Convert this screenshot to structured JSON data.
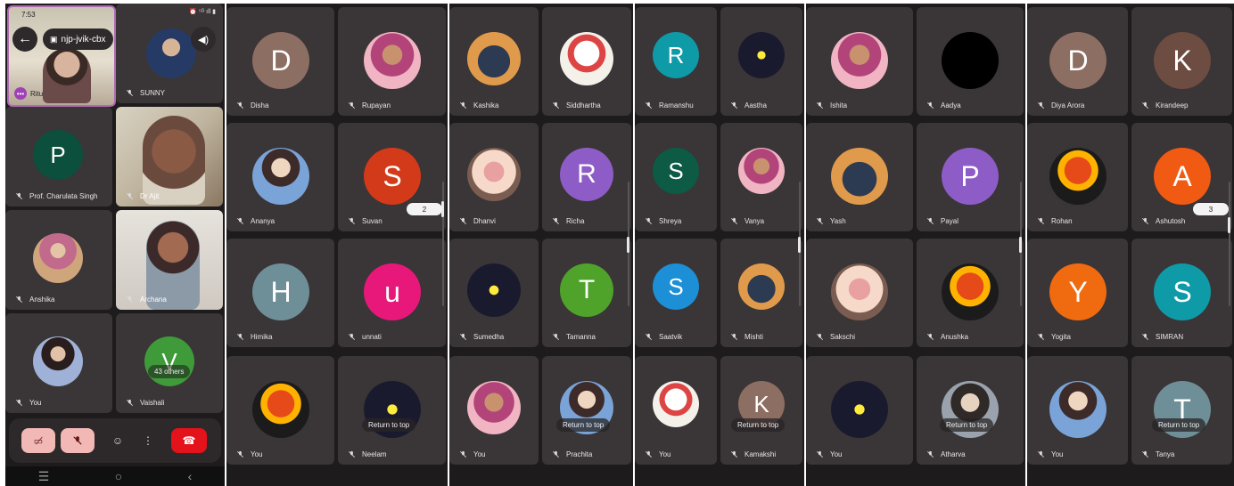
{
  "phone": {
    "status_time": "7:53",
    "status_icons": "⏰ ⁵ᴳ ıll ▮",
    "meeting_code": "njp-jvik-cbx",
    "self_preview_name": "Ritu",
    "pinned_name": "SUNNY",
    "grid": [
      {
        "name": "Prof. Charulata Singh",
        "initial": "P",
        "color": "#0b4f3c"
      },
      {
        "name": "Dr Ajit",
        "initial": "",
        "color": ""
      },
      {
        "name": "Anshika",
        "initial": "",
        "color": ""
      },
      {
        "name": "Archana",
        "initial": "",
        "color": ""
      },
      {
        "name": "You",
        "initial": "",
        "color": ""
      },
      {
        "name": "Vaishali",
        "initial": "V",
        "color": "#3f9a3a"
      }
    ],
    "others_label": "43 others",
    "nav": {
      "recents": "☰",
      "home": "○",
      "back": "‹"
    }
  },
  "panels": [
    {
      "page_badge": "2",
      "return_label": "Return to top",
      "tiles": [
        {
          "name": "Disha",
          "initial": "D",
          "color": "#8d6e63"
        },
        {
          "name": "Rupayan",
          "initial": "",
          "color": ""
        },
        {
          "name": "Ananya",
          "initial": "",
          "color": ""
        },
        {
          "name": "Suvan",
          "initial": "S",
          "color": "#d23a1a"
        },
        {
          "name": "Himika",
          "initial": "H",
          "color": "#6f8f98"
        },
        {
          "name": "unnati",
          "initial": "u",
          "color": "#e8187a"
        },
        {
          "name": "You",
          "initial": "",
          "color": ""
        },
        {
          "name": "Neelam",
          "initial": "",
          "color": ""
        }
      ]
    },
    {
      "page_badge": "",
      "return_label": "Return to top",
      "tiles": [
        {
          "name": "Kashika",
          "initial": "",
          "color": ""
        },
        {
          "name": "Siddhartha",
          "initial": "",
          "color": ""
        },
        {
          "name": "Dhanvi",
          "initial": "",
          "color": ""
        },
        {
          "name": "Richa",
          "initial": "R",
          "color": "#8e5cc6"
        },
        {
          "name": "Sumedha",
          "initial": "",
          "color": ""
        },
        {
          "name": "Tamanna",
          "initial": "T",
          "color": "#4fa32b"
        },
        {
          "name": "You",
          "initial": "",
          "color": ""
        },
        {
          "name": "Prachita",
          "initial": "",
          "color": ""
        }
      ]
    },
    {
      "page_badge": "",
      "return_label": "Return to top",
      "tiles": [
        {
          "name": "Ramanshu",
          "initial": "R",
          "color": "#0f9aa8"
        },
        {
          "name": "Aastha",
          "initial": "",
          "color": ""
        },
        {
          "name": "Shreya",
          "initial": "S",
          "color": "#0d5a45"
        },
        {
          "name": "Vanya",
          "initial": "",
          "color": ""
        },
        {
          "name": "Saatvik",
          "initial": "S",
          "color": "#1d8fd6"
        },
        {
          "name": "Mishti",
          "initial": "",
          "color": ""
        },
        {
          "name": "You",
          "initial": "",
          "color": ""
        },
        {
          "name": "Kamakshi",
          "initial": "K",
          "color": "#8d6e63"
        }
      ]
    },
    {
      "page_badge": "",
      "return_label": "Return to top",
      "tiles": [
        {
          "name": "Ishita",
          "initial": "",
          "color": ""
        },
        {
          "name": "Aadya",
          "initial": "",
          "color": "#000000"
        },
        {
          "name": "Yash",
          "initial": "",
          "color": ""
        },
        {
          "name": "Payal",
          "initial": "P",
          "color": "#8e5cc6"
        },
        {
          "name": "Sakschi",
          "initial": "",
          "color": ""
        },
        {
          "name": "Anushka",
          "initial": "",
          "color": ""
        },
        {
          "name": "You",
          "initial": "",
          "color": ""
        },
        {
          "name": "Atharva",
          "initial": "",
          "color": ""
        }
      ]
    },
    {
      "page_badge": "3",
      "return_label": "Return to top",
      "tiles": [
        {
          "name": "Diya Arora",
          "initial": "D",
          "color": "#8d6e63"
        },
        {
          "name": "Kirandeep",
          "initial": "K",
          "color": "#6d4c41"
        },
        {
          "name": "Rohan",
          "initial": "",
          "color": ""
        },
        {
          "name": "Ashutosh",
          "initial": "A",
          "color": "#f05a12"
        },
        {
          "name": "Yogita",
          "initial": "Y",
          "color": "#f06a10"
        },
        {
          "name": "SIMRAN",
          "initial": "S",
          "color": "#0f9aa8"
        },
        {
          "name": "You",
          "initial": "",
          "color": ""
        },
        {
          "name": "Tanya",
          "initial": "T",
          "color": "#6f8f98"
        }
      ]
    }
  ]
}
